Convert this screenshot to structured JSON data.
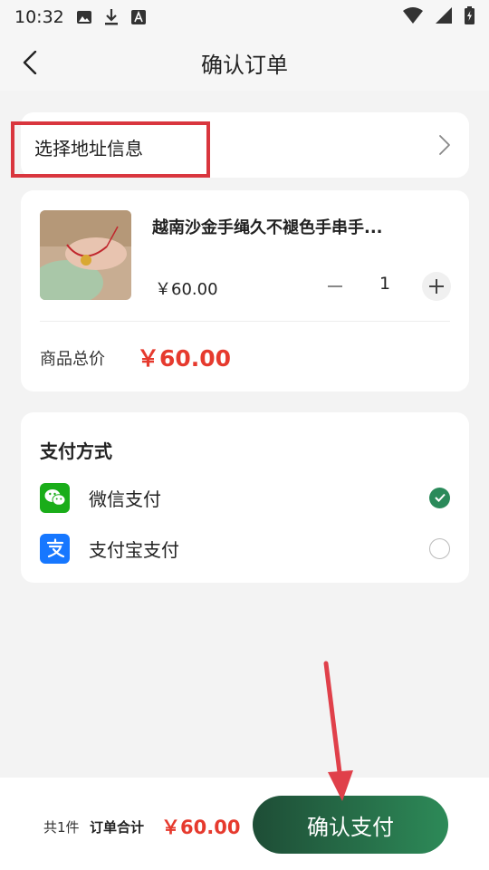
{
  "status_bar": {
    "time": "10:32"
  },
  "header": {
    "title": "确认订单"
  },
  "address": {
    "label": "选择地址信息"
  },
  "product": {
    "name": "越南沙金手绳久不褪色手串手...",
    "price": "￥60.00",
    "quantity": "1",
    "total_label": "商品总价",
    "total_value": "￥60.00"
  },
  "payment": {
    "title": "支付方式",
    "options": [
      {
        "label": "微信支付",
        "icon": "wechat-pay-icon",
        "selected": true
      },
      {
        "label": "支付宝支付",
        "icon": "alipay-icon",
        "selected": false
      }
    ]
  },
  "footer": {
    "count": "共1件",
    "sum_label": "订单合计",
    "sum_value": "￥60.00",
    "confirm_label": "确认支付"
  },
  "colors": {
    "accent": "#2a8a5a",
    "price": "#e63a2e",
    "highlight_box": "#d9363e",
    "annotation_arrow": "#e0404a"
  }
}
